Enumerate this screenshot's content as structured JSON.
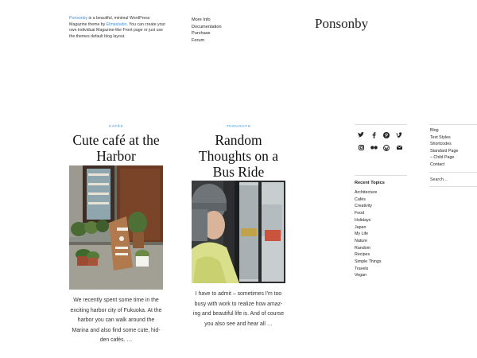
{
  "intro": {
    "link1": "Ponsonby",
    "text1": " is a beautiful, minimal WordPress Magazine theme by ",
    "link2": "Elmastudio",
    "text2": ". You can create your own individual Magazine-like Front page or just use the themes default blog layout."
  },
  "topnav": [
    "More Info",
    "Documentation",
    "Purchase",
    "Forum"
  ],
  "site_title": "Ponsonby",
  "posts": [
    {
      "category": "CAFÉS",
      "title": "Cute café at the Harbor",
      "excerpt": "We recently spent some time in the exciting harbor city of Fukuoka. At the harbor you can walk around the Marina and also find some cute, hid-den cafés. …"
    },
    {
      "category": "THOUGHTS",
      "title": "Random Thoughts on a Bus Ride",
      "excerpt": "I have to admit – sometimes I'm too busy with work to realize how amaz-ing and beautiful life is. And of course you also see and hear all …"
    }
  ],
  "social_icons": [
    "twitter-icon",
    "facebook-icon",
    "pinterest-icon",
    "vimeo-icon",
    "instagram-icon",
    "flickr-icon",
    "wordpress-icon",
    "email-icon"
  ],
  "recent_topics": {
    "heading": "Recent Topics",
    "items": [
      "Architecture",
      "Cafés",
      "Creativity",
      "Food",
      "Holidays",
      "Japan",
      "My Life",
      "Nature",
      "Random",
      "Recipes",
      "Simple Things",
      "Travels",
      "Vegan"
    ]
  },
  "pages": [
    "Blog",
    "Text Styles",
    "Shortcodes",
    "Standard Page",
    "– Child Page",
    "Contact"
  ],
  "search": {
    "placeholder": "Search…"
  },
  "colors": {
    "accent": "#3b8fd6"
  }
}
